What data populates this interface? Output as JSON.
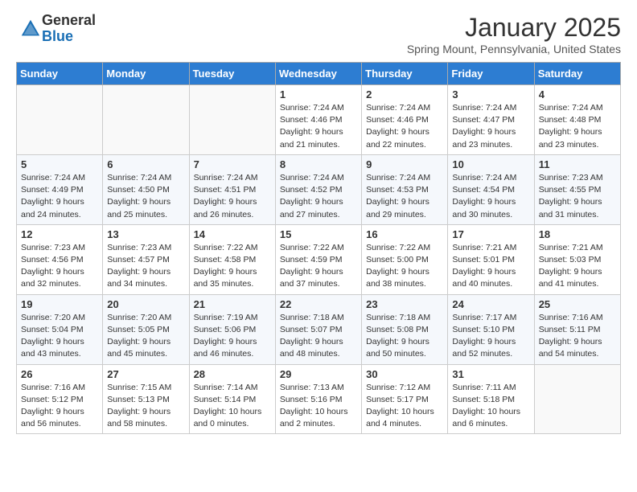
{
  "logo": {
    "general": "General",
    "blue": "Blue"
  },
  "header": {
    "title": "January 2025",
    "location": "Spring Mount, Pennsylvania, United States"
  },
  "weekdays": [
    "Sunday",
    "Monday",
    "Tuesday",
    "Wednesday",
    "Thursday",
    "Friday",
    "Saturday"
  ],
  "weeks": [
    [
      {
        "day": "",
        "info": ""
      },
      {
        "day": "",
        "info": ""
      },
      {
        "day": "",
        "info": ""
      },
      {
        "day": "1",
        "info": "Sunrise: 7:24 AM\nSunset: 4:46 PM\nDaylight: 9 hours\nand 21 minutes."
      },
      {
        "day": "2",
        "info": "Sunrise: 7:24 AM\nSunset: 4:46 PM\nDaylight: 9 hours\nand 22 minutes."
      },
      {
        "day": "3",
        "info": "Sunrise: 7:24 AM\nSunset: 4:47 PM\nDaylight: 9 hours\nand 23 minutes."
      },
      {
        "day": "4",
        "info": "Sunrise: 7:24 AM\nSunset: 4:48 PM\nDaylight: 9 hours\nand 23 minutes."
      }
    ],
    [
      {
        "day": "5",
        "info": "Sunrise: 7:24 AM\nSunset: 4:49 PM\nDaylight: 9 hours\nand 24 minutes."
      },
      {
        "day": "6",
        "info": "Sunrise: 7:24 AM\nSunset: 4:50 PM\nDaylight: 9 hours\nand 25 minutes."
      },
      {
        "day": "7",
        "info": "Sunrise: 7:24 AM\nSunset: 4:51 PM\nDaylight: 9 hours\nand 26 minutes."
      },
      {
        "day": "8",
        "info": "Sunrise: 7:24 AM\nSunset: 4:52 PM\nDaylight: 9 hours\nand 27 minutes."
      },
      {
        "day": "9",
        "info": "Sunrise: 7:24 AM\nSunset: 4:53 PM\nDaylight: 9 hours\nand 29 minutes."
      },
      {
        "day": "10",
        "info": "Sunrise: 7:24 AM\nSunset: 4:54 PM\nDaylight: 9 hours\nand 30 minutes."
      },
      {
        "day": "11",
        "info": "Sunrise: 7:23 AM\nSunset: 4:55 PM\nDaylight: 9 hours\nand 31 minutes."
      }
    ],
    [
      {
        "day": "12",
        "info": "Sunrise: 7:23 AM\nSunset: 4:56 PM\nDaylight: 9 hours\nand 32 minutes."
      },
      {
        "day": "13",
        "info": "Sunrise: 7:23 AM\nSunset: 4:57 PM\nDaylight: 9 hours\nand 34 minutes."
      },
      {
        "day": "14",
        "info": "Sunrise: 7:22 AM\nSunset: 4:58 PM\nDaylight: 9 hours\nand 35 minutes."
      },
      {
        "day": "15",
        "info": "Sunrise: 7:22 AM\nSunset: 4:59 PM\nDaylight: 9 hours\nand 37 minutes."
      },
      {
        "day": "16",
        "info": "Sunrise: 7:22 AM\nSunset: 5:00 PM\nDaylight: 9 hours\nand 38 minutes."
      },
      {
        "day": "17",
        "info": "Sunrise: 7:21 AM\nSunset: 5:01 PM\nDaylight: 9 hours\nand 40 minutes."
      },
      {
        "day": "18",
        "info": "Sunrise: 7:21 AM\nSunset: 5:03 PM\nDaylight: 9 hours\nand 41 minutes."
      }
    ],
    [
      {
        "day": "19",
        "info": "Sunrise: 7:20 AM\nSunset: 5:04 PM\nDaylight: 9 hours\nand 43 minutes."
      },
      {
        "day": "20",
        "info": "Sunrise: 7:20 AM\nSunset: 5:05 PM\nDaylight: 9 hours\nand 45 minutes."
      },
      {
        "day": "21",
        "info": "Sunrise: 7:19 AM\nSunset: 5:06 PM\nDaylight: 9 hours\nand 46 minutes."
      },
      {
        "day": "22",
        "info": "Sunrise: 7:18 AM\nSunset: 5:07 PM\nDaylight: 9 hours\nand 48 minutes."
      },
      {
        "day": "23",
        "info": "Sunrise: 7:18 AM\nSunset: 5:08 PM\nDaylight: 9 hours\nand 50 minutes."
      },
      {
        "day": "24",
        "info": "Sunrise: 7:17 AM\nSunset: 5:10 PM\nDaylight: 9 hours\nand 52 minutes."
      },
      {
        "day": "25",
        "info": "Sunrise: 7:16 AM\nSunset: 5:11 PM\nDaylight: 9 hours\nand 54 minutes."
      }
    ],
    [
      {
        "day": "26",
        "info": "Sunrise: 7:16 AM\nSunset: 5:12 PM\nDaylight: 9 hours\nand 56 minutes."
      },
      {
        "day": "27",
        "info": "Sunrise: 7:15 AM\nSunset: 5:13 PM\nDaylight: 9 hours\nand 58 minutes."
      },
      {
        "day": "28",
        "info": "Sunrise: 7:14 AM\nSunset: 5:14 PM\nDaylight: 10 hours\nand 0 minutes."
      },
      {
        "day": "29",
        "info": "Sunrise: 7:13 AM\nSunset: 5:16 PM\nDaylight: 10 hours\nand 2 minutes."
      },
      {
        "day": "30",
        "info": "Sunrise: 7:12 AM\nSunset: 5:17 PM\nDaylight: 10 hours\nand 4 minutes."
      },
      {
        "day": "31",
        "info": "Sunrise: 7:11 AM\nSunset: 5:18 PM\nDaylight: 10 hours\nand 6 minutes."
      },
      {
        "day": "",
        "info": ""
      }
    ]
  ]
}
